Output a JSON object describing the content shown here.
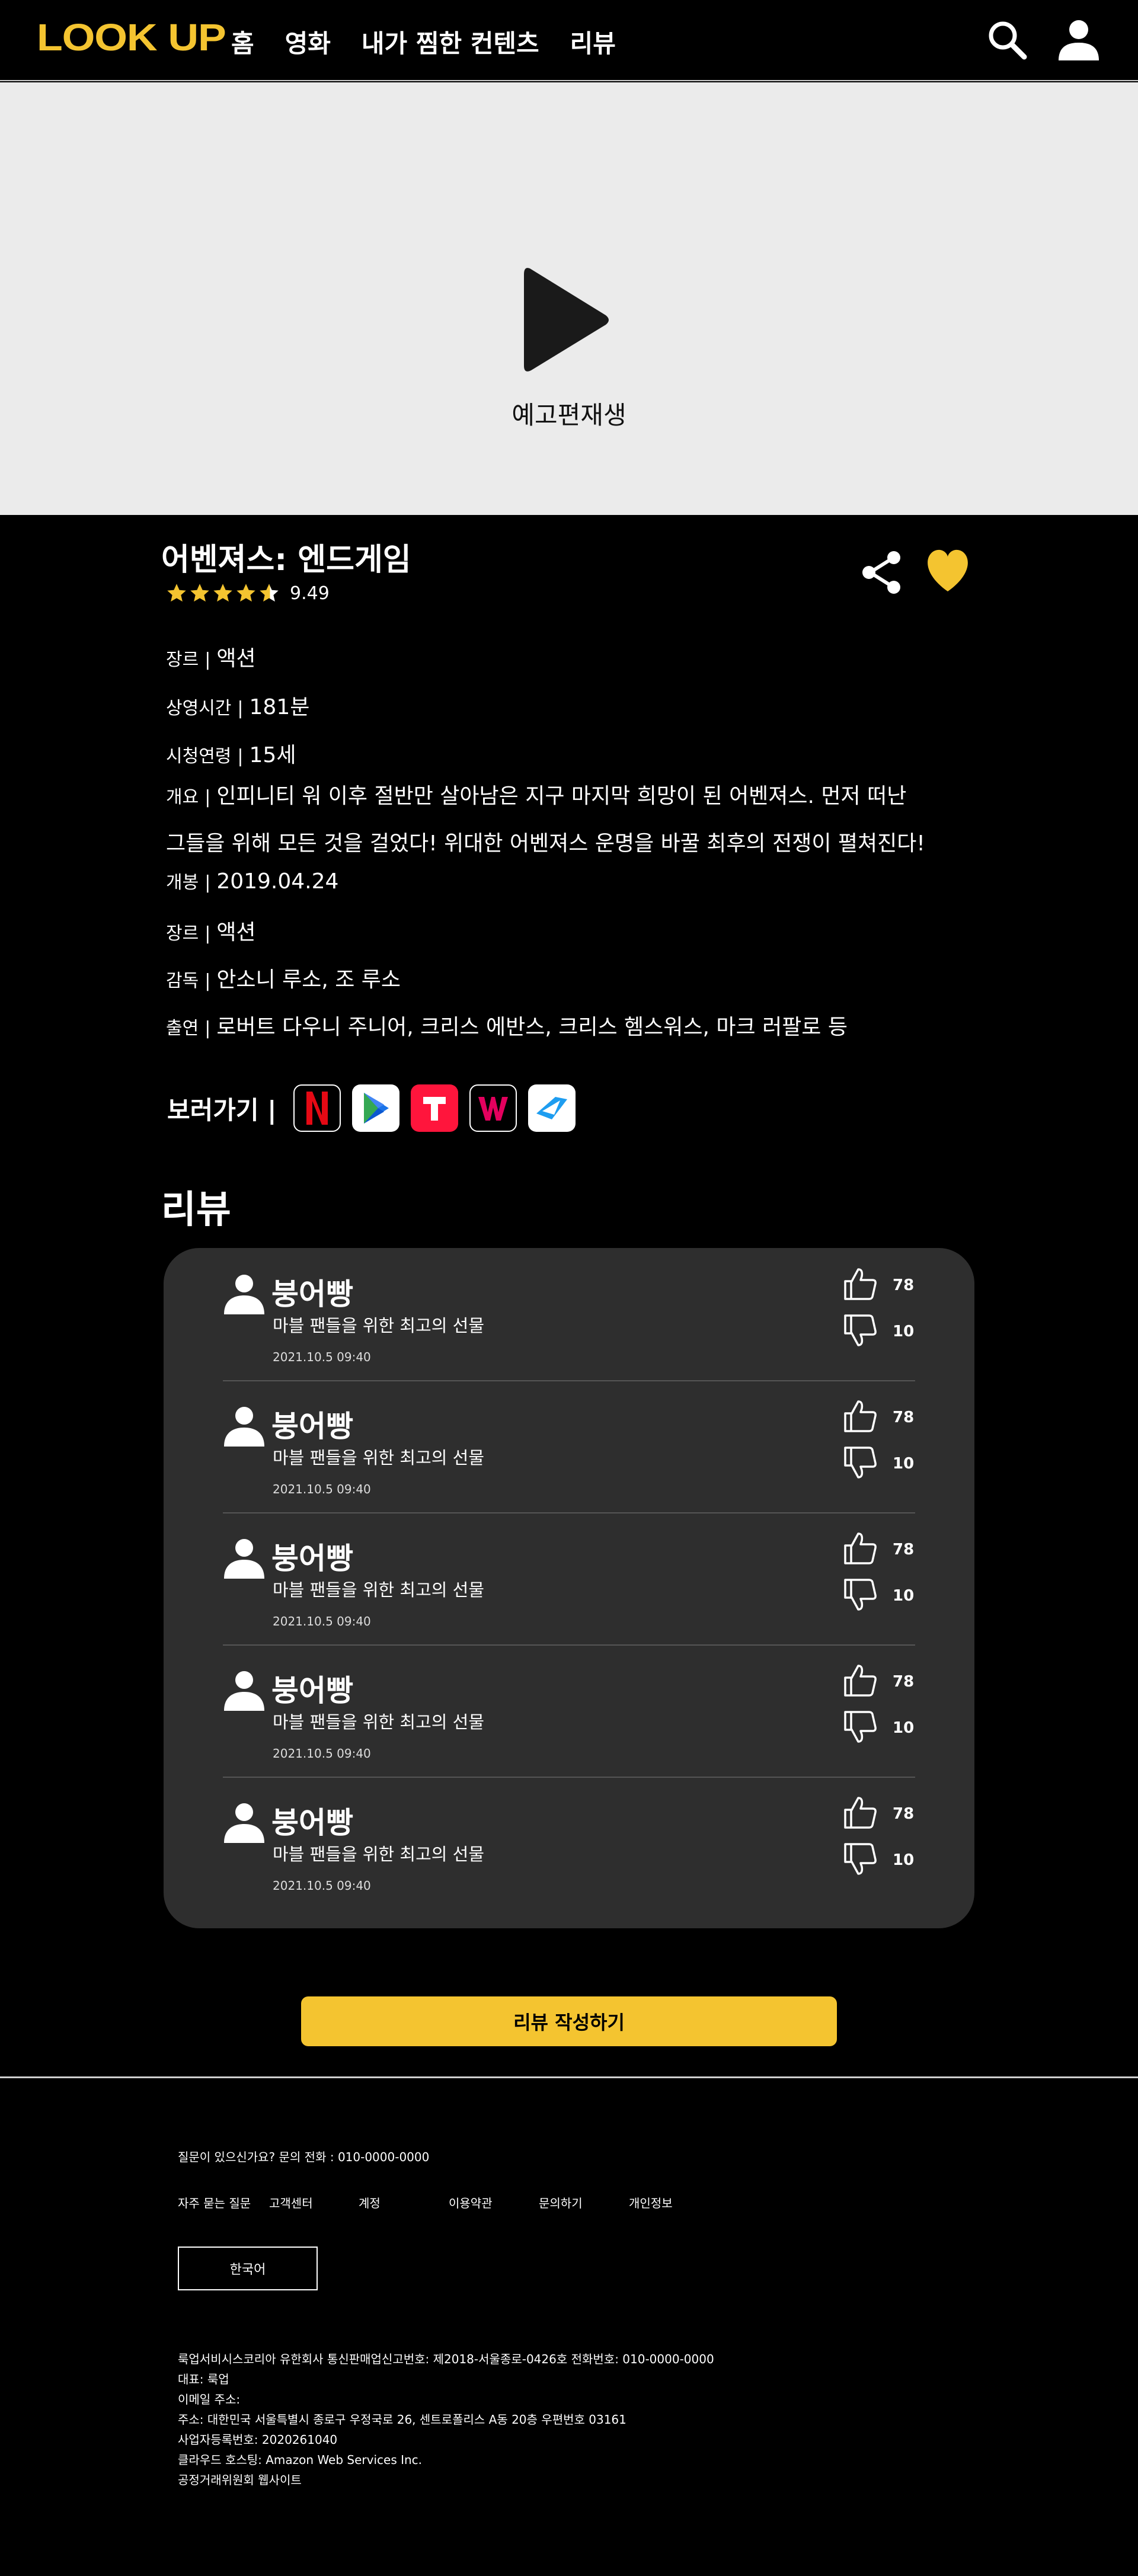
{
  "header": {
    "logo": "LOOK UP",
    "nav": [
      "홈",
      "영화",
      "내가 찜한 컨텐츠",
      "리뷰"
    ]
  },
  "video": {
    "label": "예고편재생"
  },
  "movie": {
    "title": "어벤져스: 엔드게임",
    "rating": "9.49",
    "stars_filled": 4.5,
    "info": [
      {
        "label": "장르",
        "value": "액션"
      },
      {
        "label": "상영시간",
        "value": "181분"
      },
      {
        "label": "시청연령",
        "value": "15세"
      },
      {
        "label": "개요",
        "value": "인피니티 워 이후 절반만 살아남은 지구 마지막 희망이 된 어벤져스. 먼저 떠난"
      },
      {
        "label": "",
        "value": "그들을 위해 모든 것을 걸었다! 위대한 어벤져스 운명을 바꿀 최후의 전쟁이 펼쳐진다!"
      },
      {
        "label": "개봉",
        "value": "2019.04.24"
      },
      {
        "label": "장르",
        "value": "액션"
      },
      {
        "label": "감독",
        "value": "안소니 루소, 조 루소"
      },
      {
        "label": "출연",
        "value": "로버트 다우니 주니어, 크리스 에반스, 크리스 헴스워스, 마크 러팔로 등"
      }
    ],
    "watch_label": "보러가기",
    "ott": [
      "netflix-icon",
      "google-play-icon",
      "tving-icon",
      "wavve-icon",
      "naver-series-icon"
    ],
    "colors": {
      "accent": "#f4c430",
      "netflix": "#e50914",
      "tving": "#ff153c",
      "wavve": "#e4005e"
    }
  },
  "reviews": {
    "title": "리뷰",
    "items": [
      {
        "name": "붕어빵",
        "text": "마블 팬들을 위한 최고의 선물",
        "date": "2021.10.5 09:40",
        "likes": "78",
        "dislikes": "10"
      },
      {
        "name": "붕어빵",
        "text": "마블 팬들을 위한 최고의 선물",
        "date": "2021.10.5 09:40",
        "likes": "78",
        "dislikes": "10"
      },
      {
        "name": "붕어빵",
        "text": "마블 팬들을 위한 최고의 선물",
        "date": "2021.10.5 09:40",
        "likes": "78",
        "dislikes": "10"
      },
      {
        "name": "붕어빵",
        "text": "마블 팬들을 위한 최고의 선물",
        "date": "2021.10.5 09:40",
        "likes": "78",
        "dislikes": "10"
      },
      {
        "name": "붕어빵",
        "text": "마블 팬들을 위한 최고의 선물",
        "date": "2021.10.5 09:40",
        "likes": "78",
        "dislikes": "10"
      }
    ],
    "write_button": "리뷰 작성하기"
  },
  "footer": {
    "question": "질문이 있으신가요? 문의 전화 : 010-0000-0000",
    "links": [
      "자주 묻는 질문",
      "고객센터",
      "계정",
      "이용약관",
      "문의하기",
      "개인정보"
    ],
    "language": "한국어",
    "company": [
      "룩업서비시스코리아 유한회사 통신판매업신고번호: 제2018-서울종로-0426호 전화번호: 010-0000-0000",
      "대표: 룩업",
      "이메일 주소:",
      "주소: 대한민국 서울특별시 종로구 우정국로 26, 센트로폴리스 A동 20층 우편번호 03161",
      "사업자등록번호: 2020261040",
      "클라우드 호스팅: Amazon Web Services Inc.",
      "공정거래위원회 웹사이트"
    ]
  }
}
